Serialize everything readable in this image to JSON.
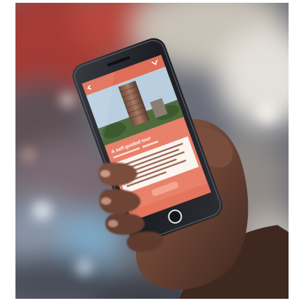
{
  "photo": {
    "subject": "hand holding smartphone",
    "colors": {
      "frame": "#ffffff",
      "bokeh_red": "#a43a34",
      "bokeh_blue": "#7fa7c4",
      "phone_body": "#1c1d22",
      "skin": "#6a4334"
    }
  },
  "app": {
    "accent": "#df6e57",
    "screen_bg": "#e9806a",
    "title": "A self-guided tour"
  }
}
